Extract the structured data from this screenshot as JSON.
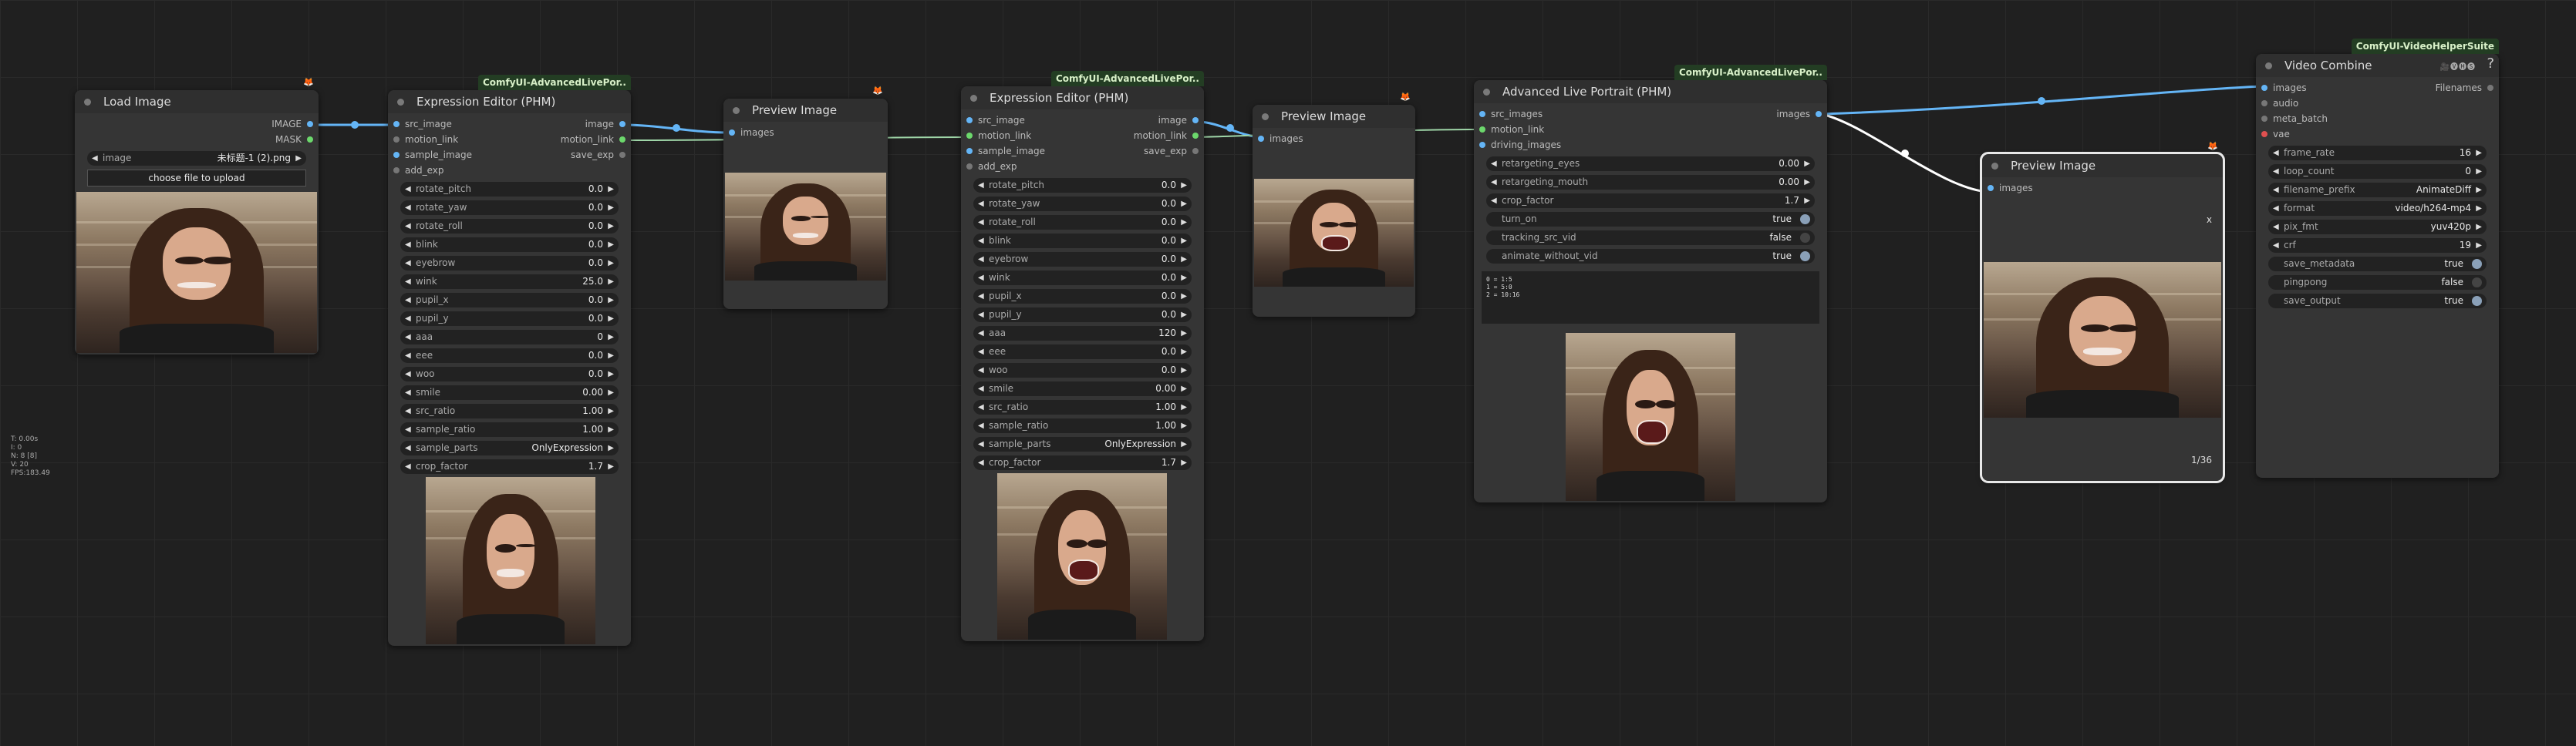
{
  "canvas_stats": [
    "T: 0.00s",
    "I: 0",
    "N: 8 [8]",
    "V: 20",
    "FPS:183.49"
  ],
  "load_image": {
    "title": "Load Image",
    "outputs": [
      "IMAGE",
      "MASK"
    ],
    "image_label": "image",
    "image_value": "未标题-1 (2).png",
    "upload_label": "choose file to upload"
  },
  "editor1": {
    "title": "Expression Editor (PHM)",
    "badge": "ComfyUI-AdvancedLivePor..",
    "inputs": [
      "src_image",
      "motion_link",
      "sample_image",
      "add_exp"
    ],
    "outputs": [
      "image",
      "motion_link",
      "save_exp"
    ],
    "widgets": [
      {
        "name": "rotate_pitch",
        "value": "0.0"
      },
      {
        "name": "rotate_yaw",
        "value": "0.0"
      },
      {
        "name": "rotate_roll",
        "value": "0.0"
      },
      {
        "name": "blink",
        "value": "0.0"
      },
      {
        "name": "eyebrow",
        "value": "0.0"
      },
      {
        "name": "wink",
        "value": "25.0"
      },
      {
        "name": "pupil_x",
        "value": "0.0"
      },
      {
        "name": "pupil_y",
        "value": "0.0"
      },
      {
        "name": "aaa",
        "value": "0"
      },
      {
        "name": "eee",
        "value": "0.0"
      },
      {
        "name": "woo",
        "value": "0.0"
      },
      {
        "name": "smile",
        "value": "0.00"
      },
      {
        "name": "src_ratio",
        "value": "1.00"
      },
      {
        "name": "sample_ratio",
        "value": "1.00"
      },
      {
        "name": "sample_parts",
        "value": "OnlyExpression"
      },
      {
        "name": "crop_factor",
        "value": "1.7"
      }
    ]
  },
  "preview1": {
    "title": "Preview Image",
    "inputs": [
      "images"
    ]
  },
  "editor2": {
    "title": "Expression Editor (PHM)",
    "badge": "ComfyUI-AdvancedLivePor..",
    "inputs": [
      "src_image",
      "motion_link",
      "sample_image",
      "add_exp"
    ],
    "outputs": [
      "image",
      "motion_link",
      "save_exp"
    ],
    "widgets": [
      {
        "name": "rotate_pitch",
        "value": "0.0"
      },
      {
        "name": "rotate_yaw",
        "value": "0.0"
      },
      {
        "name": "rotate_roll",
        "value": "0.0"
      },
      {
        "name": "blink",
        "value": "0.0"
      },
      {
        "name": "eyebrow",
        "value": "0.0"
      },
      {
        "name": "wink",
        "value": "0.0"
      },
      {
        "name": "pupil_x",
        "value": "0.0"
      },
      {
        "name": "pupil_y",
        "value": "0.0"
      },
      {
        "name": "aaa",
        "value": "120"
      },
      {
        "name": "eee",
        "value": "0.0"
      },
      {
        "name": "woo",
        "value": "0.0"
      },
      {
        "name": "smile",
        "value": "0.00"
      },
      {
        "name": "src_ratio",
        "value": "1.00"
      },
      {
        "name": "sample_ratio",
        "value": "1.00"
      },
      {
        "name": "sample_parts",
        "value": "OnlyExpression"
      },
      {
        "name": "crop_factor",
        "value": "1.7"
      }
    ]
  },
  "preview2": {
    "title": "Preview Image",
    "inputs": [
      "images"
    ]
  },
  "alp": {
    "title": "Advanced Live Portrait (PHM)",
    "badge": "ComfyUI-AdvancedLivePor..",
    "inputs": [
      "src_images",
      "motion_link",
      "driving_images"
    ],
    "outputs": [
      "images"
    ],
    "widgets": [
      {
        "name": "retargeting_eyes",
        "value": "0.00"
      },
      {
        "name": "retargeting_mouth",
        "value": "0.00"
      },
      {
        "name": "crop_factor",
        "value": "1.7"
      }
    ],
    "toggles": [
      {
        "name": "turn_on",
        "value": "true"
      },
      {
        "name": "tracking_src_vid",
        "value": "false"
      },
      {
        "name": "animate_without_vid",
        "value": "true"
      }
    ],
    "text": "0 = 1:5\n1 = 5:0\n2 = 10:16"
  },
  "preview3": {
    "title": "Preview Image",
    "inputs": [
      "images"
    ],
    "close": "x",
    "counter": "1/36"
  },
  "video": {
    "title": "Video Combine",
    "badge": "ComfyUI-VideoHelperSuite",
    "icons": "🎥🅥🅗🅢",
    "help": "?",
    "inputs": [
      "images",
      "audio",
      "meta_batch",
      "vae"
    ],
    "outputs": [
      "Filenames"
    ],
    "widgets": [
      {
        "name": "frame_rate",
        "value": "16"
      },
      {
        "name": "loop_count",
        "value": "0"
      },
      {
        "name": "filename_prefix",
        "value": "AnimateDiff"
      },
      {
        "name": "format",
        "value": "video/h264-mp4"
      },
      {
        "name": "pix_fmt",
        "value": "yuv420p"
      },
      {
        "name": "crf",
        "value": "19"
      }
    ],
    "toggles": [
      {
        "name": "save_metadata",
        "value": "true"
      },
      {
        "name": "pingpong",
        "value": "false"
      },
      {
        "name": "save_output",
        "value": "true"
      }
    ]
  }
}
